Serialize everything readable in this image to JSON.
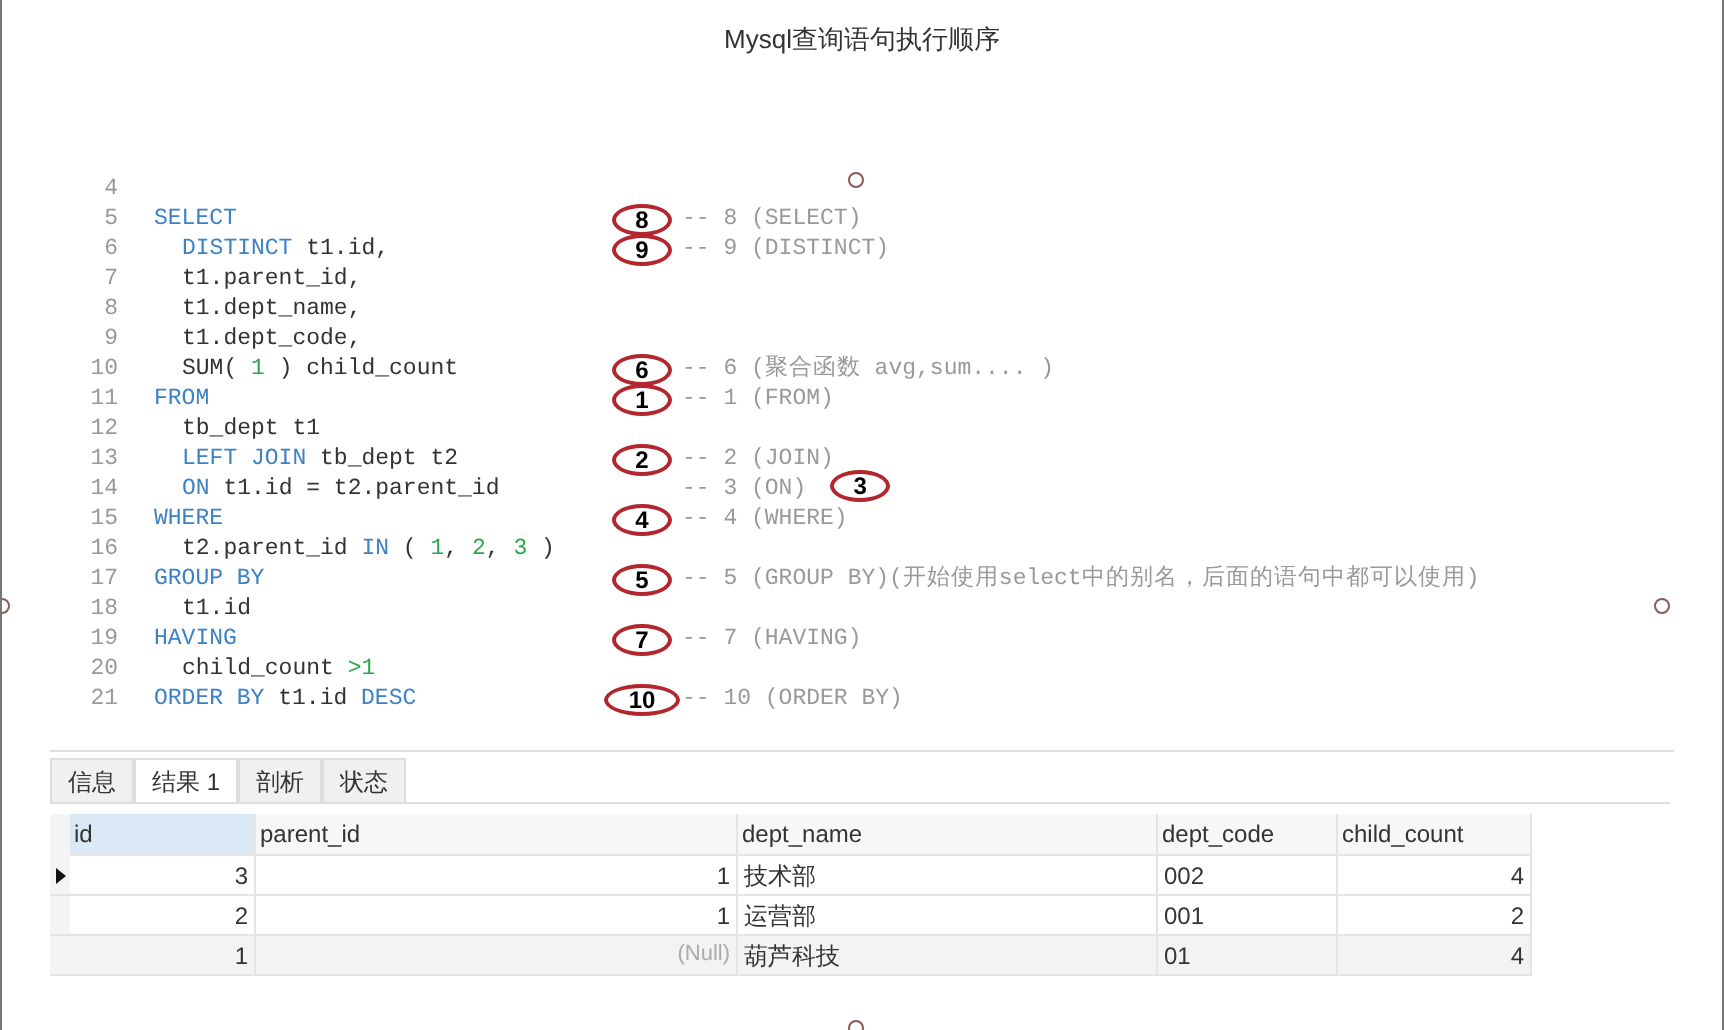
{
  "window": {
    "title": "Mysql查询语句执行顺序"
  },
  "editor": {
    "lines": [
      {
        "number": "4"
      },
      {
        "number": "5",
        "tokens": [
          {
            "kind": "keyword",
            "text": "SELECT"
          }
        ],
        "badge": "8",
        "comment": "-- 8 (SELECT)"
      },
      {
        "number": "6",
        "indent": true,
        "tokens": [
          {
            "kind": "keyword",
            "text": "DISTINCT"
          },
          {
            "kind": "plain",
            "text": " t1.id,"
          }
        ],
        "badge": "9",
        "comment": "-- 9 (DISTINCT)"
      },
      {
        "number": "7",
        "indent": true,
        "tokens": [
          {
            "kind": "plain",
            "text": "t1.parent_id,"
          }
        ]
      },
      {
        "number": "8",
        "indent": true,
        "tokens": [
          {
            "kind": "plain",
            "text": "t1.dept_name,"
          }
        ]
      },
      {
        "number": "9",
        "indent": true,
        "tokens": [
          {
            "kind": "plain",
            "text": "t1.dept_code,"
          }
        ]
      },
      {
        "number": "10",
        "indent": true,
        "tokens": [
          {
            "kind": "plain",
            "text": "SUM( "
          },
          {
            "kind": "number",
            "text": "1"
          },
          {
            "kind": "plain",
            "text": " ) child_count"
          }
        ],
        "badge": "6",
        "comment": "-- 6 (聚合函数 avg,sum.... )"
      },
      {
        "number": "11",
        "tokens": [
          {
            "kind": "keyword",
            "text": "FROM"
          }
        ],
        "badge": "1",
        "comment": "-- 1 (FROM)"
      },
      {
        "number": "12",
        "indent": true,
        "tokens": [
          {
            "kind": "plain",
            "text": "tb_dept t1"
          }
        ]
      },
      {
        "number": "13",
        "indent": true,
        "tokens": [
          {
            "kind": "keyword",
            "text": "LEFT JOIN"
          },
          {
            "kind": "plain",
            "text": " tb_dept t2"
          }
        ],
        "badge": "2",
        "comment": "-- 2 (JOIN)"
      },
      {
        "number": "14",
        "indent": true,
        "tokens": [
          {
            "kind": "keyword",
            "text": "ON"
          },
          {
            "kind": "plain",
            "text": " t1.id = t2.parent_id"
          }
        ],
        "comment": "-- 3 (ON)",
        "badge_after": "3"
      },
      {
        "number": "15",
        "tokens": [
          {
            "kind": "keyword",
            "text": "WHERE"
          }
        ],
        "badge": "4",
        "comment": "-- 4 (WHERE)"
      },
      {
        "number": "16",
        "indent": true,
        "tokens": [
          {
            "kind": "plain",
            "text": "t2.parent_id "
          },
          {
            "kind": "keyword",
            "text": "IN"
          },
          {
            "kind": "plain",
            "text": " ( "
          },
          {
            "kind": "number",
            "text": "1"
          },
          {
            "kind": "plain",
            "text": ", "
          },
          {
            "kind": "number",
            "text": "2"
          },
          {
            "kind": "plain",
            "text": ", "
          },
          {
            "kind": "number",
            "text": "3"
          },
          {
            "kind": "plain",
            "text": " )"
          }
        ]
      },
      {
        "number": "17",
        "tokens": [
          {
            "kind": "keyword",
            "text": "GROUP BY"
          }
        ],
        "badge": "5",
        "comment": "-- 5 (GROUP BY)(开始使用select中的别名，后面的语句中都可以使用)"
      },
      {
        "number": "18",
        "indent": true,
        "tokens": [
          {
            "kind": "plain",
            "text": "t1.id"
          }
        ]
      },
      {
        "number": "19",
        "tokens": [
          {
            "kind": "keyword",
            "text": "HAVING"
          }
        ],
        "badge": "7",
        "comment": "-- 7 (HAVING)"
      },
      {
        "number": "20",
        "indent": true,
        "tokens": [
          {
            "kind": "plain",
            "text": "child_count "
          },
          {
            "kind": "number",
            "text": ">1"
          }
        ]
      },
      {
        "number": "21",
        "tokens": [
          {
            "kind": "keyword",
            "text": "ORDER BY"
          },
          {
            "kind": "plain",
            "text": " t1.id "
          },
          {
            "kind": "keyword",
            "text": "DESC"
          }
        ],
        "badge": "10",
        "comment": "-- 10 (ORDER BY)"
      }
    ]
  },
  "result_tabs": [
    {
      "label": "信息",
      "selected": false
    },
    {
      "label": "结果 1",
      "selected": true
    },
    {
      "label": "剖析",
      "selected": false
    },
    {
      "label": "状态",
      "selected": false
    }
  ],
  "table": {
    "columns": [
      {
        "label": "id",
        "selected": true
      },
      {
        "label": "parent_id",
        "selected": false
      },
      {
        "label": "dept_name",
        "selected": false
      },
      {
        "label": "dept_code",
        "selected": false
      },
      {
        "label": "child_count",
        "selected": false
      }
    ],
    "rows": [
      {
        "selected": true,
        "cells": [
          {
            "text": "3",
            "kind": "number"
          },
          {
            "text": "1",
            "kind": "number"
          },
          {
            "text": "技术部",
            "kind": "text"
          },
          {
            "text": "002",
            "kind": "text"
          },
          {
            "text": "4",
            "kind": "number"
          }
        ]
      },
      {
        "selected": false,
        "cells": [
          {
            "text": "2",
            "kind": "number"
          },
          {
            "text": "1",
            "kind": "number"
          },
          {
            "text": "运营部",
            "kind": "text"
          },
          {
            "text": "001",
            "kind": "text"
          },
          {
            "text": "2",
            "kind": "number"
          }
        ]
      },
      {
        "selected": false,
        "cells": [
          {
            "text": "1",
            "kind": "number"
          },
          {
            "text": "(Null)",
            "kind": "null"
          },
          {
            "text": "葫芦科技",
            "kind": "text"
          },
          {
            "text": "01",
            "kind": "text"
          },
          {
            "text": "4",
            "kind": "number"
          }
        ]
      }
    ]
  }
}
